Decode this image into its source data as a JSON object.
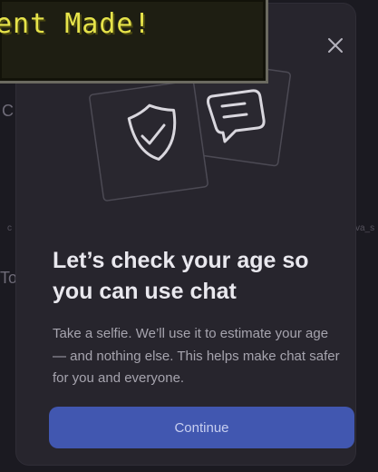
{
  "background": {
    "fragments": [
      "C",
      "c",
      "To",
      "va_s"
    ]
  },
  "toast": {
    "text": "ent Made!"
  },
  "modal": {
    "title": "Let’s check your age so you can use chat",
    "description": "Take a selfie. We’ll use it to estimate your age — and nothing else. This helps make chat safer for you and everyone.",
    "continue_label": "Continue",
    "close_icon": "close-icon",
    "illustration_icons": [
      "shield-check-icon",
      "chat-bubble-icon"
    ]
  },
  "colors": {
    "modal_bg": "#27252d",
    "accent_button": "#4157b0",
    "toast_text": "#e6e34a"
  }
}
